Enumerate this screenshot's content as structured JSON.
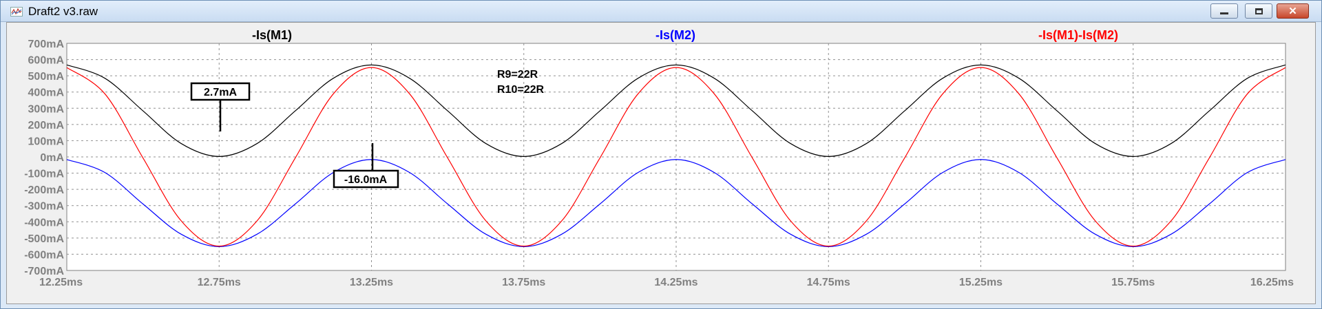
{
  "window": {
    "title": "Draft2 v3.raw",
    "icon": "waveform-viewer-icon",
    "buttons": {
      "minimize": "▭",
      "maximize": "□",
      "close": "✕"
    }
  },
  "traces": [
    {
      "label": "-Is(M1)",
      "color": "#000000"
    },
    {
      "label": "-Is(M2)",
      "color": "#0000ff"
    },
    {
      "label": "-Is(M1)-Is(M2)",
      "color": "#ff0000"
    }
  ],
  "directives": {
    "line1": "R9=22R",
    "line2": "R10=22R"
  },
  "cursors": {
    "label1": "2.7mA",
    "label2": "-16.0mA"
  },
  "chart_data": {
    "type": "line",
    "xlabel": "",
    "ylabel": "",
    "x_unit": "ms",
    "y_unit": "mA",
    "xlim": [
      12.25,
      16.25
    ],
    "ylim": [
      -700,
      700
    ],
    "x_ticks": [
      "12.25ms",
      "12.75ms",
      "13.25ms",
      "13.75ms",
      "14.25ms",
      "14.75ms",
      "15.25ms",
      "15.75ms",
      "16.25ms"
    ],
    "y_ticks": [
      "700mA",
      "600mA",
      "500mA",
      "400mA",
      "300mA",
      "200mA",
      "100mA",
      "0mA",
      "-100mA",
      "-200mA",
      "-300mA",
      "-400mA",
      "-500mA",
      "-600mA",
      "-700mA"
    ],
    "grid": true,
    "series": [
      {
        "name": "-Is(M1)",
        "color": "#000000",
        "x": [
          12.25,
          12.375,
          12.5,
          12.625,
          12.75,
          12.875,
          13.0,
          13.125,
          13.25,
          13.375,
          13.5,
          13.625,
          13.75,
          13.875,
          14.0,
          14.125,
          14.25,
          14.375,
          14.5,
          14.625,
          14.75,
          14.875,
          15.0,
          15.125,
          15.25,
          15.375,
          15.5,
          15.625,
          15.75,
          15.875,
          16.0,
          16.125,
          16.25
        ],
        "values": [
          567,
          485,
          284,
          83,
          2.7,
          83,
          284,
          485,
          567,
          485,
          284,
          83,
          2.7,
          83,
          284,
          485,
          567,
          485,
          284,
          83,
          2.7,
          83,
          284,
          485,
          567,
          485,
          284,
          83,
          2.7,
          83,
          284,
          485,
          567
        ]
      },
      {
        "name": "-Is(M2)",
        "color": "#0000ff",
        "x": [
          12.25,
          12.375,
          12.5,
          12.625,
          12.75,
          12.875,
          13.0,
          13.125,
          13.25,
          13.375,
          13.5,
          13.625,
          13.75,
          13.875,
          14.0,
          14.125,
          14.25,
          14.375,
          14.5,
          14.625,
          14.75,
          14.875,
          15.0,
          15.125,
          15.25,
          15.375,
          15.5,
          15.625,
          15.75,
          15.875,
          16.0,
          16.125,
          16.25
        ],
        "values": [
          -16,
          -96,
          -290,
          -476,
          -553,
          -476,
          -290,
          -96,
          -16,
          -96,
          -290,
          -476,
          -553,
          -476,
          -290,
          -96,
          -16,
          -96,
          -290,
          -476,
          -553,
          -476,
          -290,
          -96,
          -16,
          -96,
          -290,
          -476,
          -553,
          -476,
          -290,
          -96,
          -16
        ]
      },
      {
        "name": "-Is(M1)-Is(M2)",
        "color": "#ff0000",
        "x": [
          12.25,
          12.375,
          12.5,
          12.625,
          12.75,
          12.875,
          13.0,
          13.125,
          13.25,
          13.375,
          13.5,
          13.625,
          13.75,
          13.875,
          14.0,
          14.125,
          14.25,
          14.375,
          14.5,
          14.625,
          14.75,
          14.875,
          15.0,
          15.125,
          15.25,
          15.375,
          15.5,
          15.625,
          15.75,
          15.875,
          16.0,
          16.125,
          16.25
        ],
        "values": [
          551,
          389,
          -6,
          -393,
          -550,
          -393,
          -6,
          389,
          551,
          389,
          -6,
          -393,
          -550,
          -393,
          -6,
          389,
          551,
          389,
          -6,
          -393,
          -550,
          -393,
          -6,
          389,
          551,
          389,
          -6,
          -393,
          -550,
          -393,
          -6,
          389,
          551
        ]
      }
    ]
  }
}
